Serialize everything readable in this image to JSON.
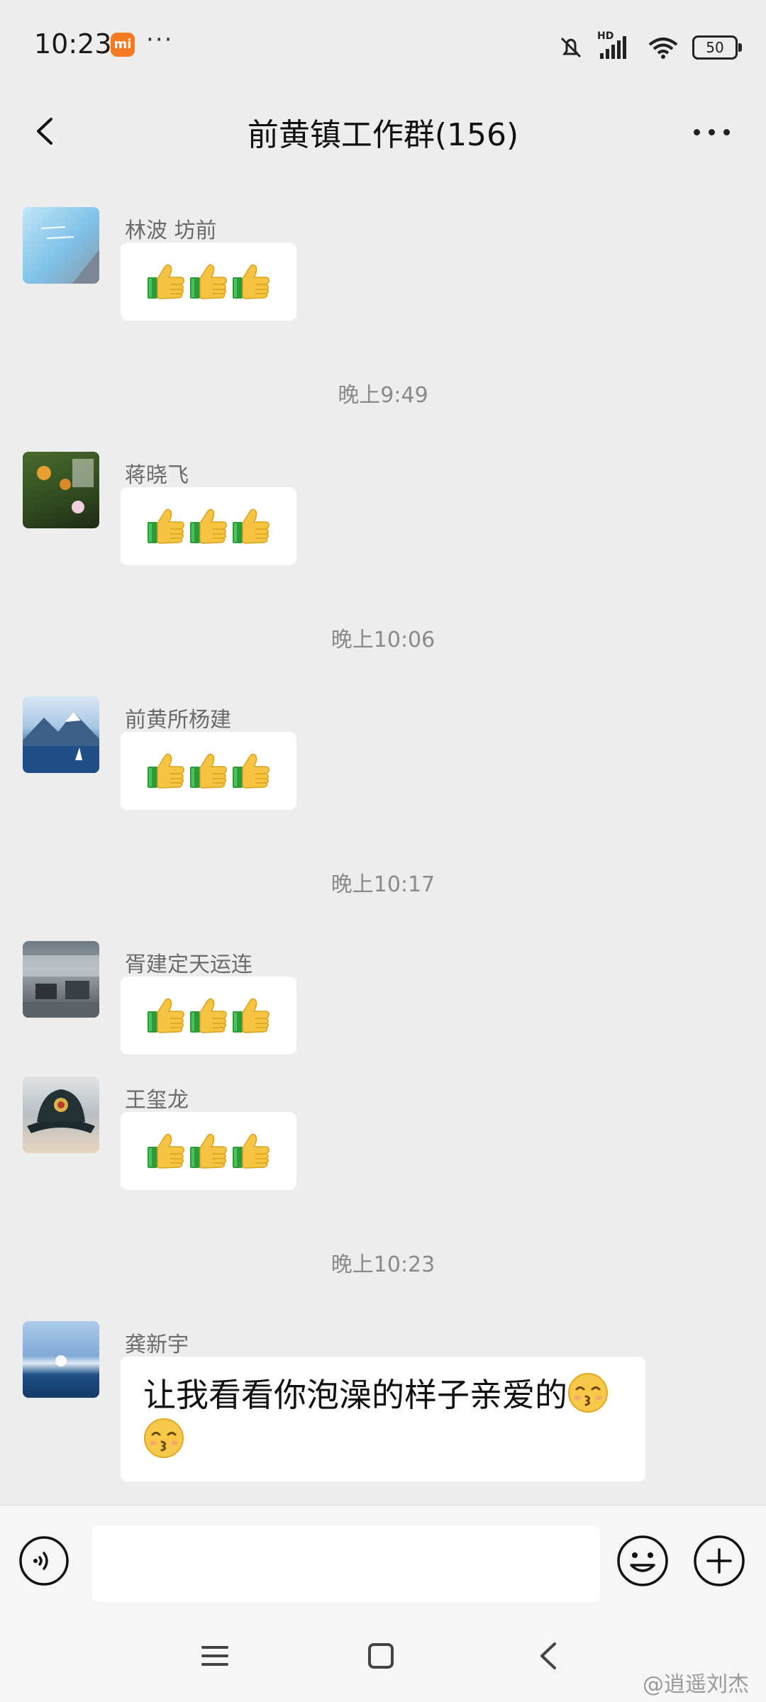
{
  "status_bar": {
    "time": "10:23",
    "mi_badge": "mi",
    "dots": "···",
    "network_label": "HD",
    "battery": "50"
  },
  "header": {
    "title": "前黄镇工作群(156)",
    "back_icon": "chevron-left-icon",
    "more_icon": "more-horizontal-icon"
  },
  "messages": [
    {
      "sender": "林波 坊前",
      "content": "thumbs",
      "emoji_icon": "thumbs-up-icon",
      "count": 3
    },
    {
      "sender": "蒋晓飞",
      "content": "thumbs",
      "emoji_icon": "thumbs-up-icon",
      "count": 3
    },
    {
      "sender": "前黄所杨建",
      "content": "thumbs",
      "emoji_icon": "thumbs-up-icon",
      "count": 3
    },
    {
      "sender": "胥建定天运连",
      "content": "thumbs",
      "emoji_icon": "thumbs-up-icon",
      "count": 3
    },
    {
      "sender": "王玺龙",
      "content": "thumbs",
      "emoji_icon": "thumbs-up-icon",
      "count": 3
    },
    {
      "sender": "龚新宇",
      "text": "让我看看你泡澡的样子亲爱的",
      "emoji_icon": "kissing-face-icon"
    }
  ],
  "time_separators": [
    "晚上9:49",
    "晚上10:06",
    "晚上10:17",
    "晚上10:23"
  ],
  "input_bar": {
    "voice_icon": "voice-icon",
    "emoji_icon": "smiley-icon",
    "plus_icon": "plus-circle-icon",
    "input_value": ""
  },
  "nav_bar": {
    "menu_icon": "menu-icon",
    "home_icon": "home-square-icon",
    "back_icon": "back-triangle-icon"
  },
  "watermark": "@逍遥刘杰",
  "colors": {
    "background": "#ededed",
    "bubble": "#ffffff",
    "mi_orange": "#f57a23",
    "thumb_yellow": "#f5c542",
    "cuff_green": "#2e9b3a"
  }
}
